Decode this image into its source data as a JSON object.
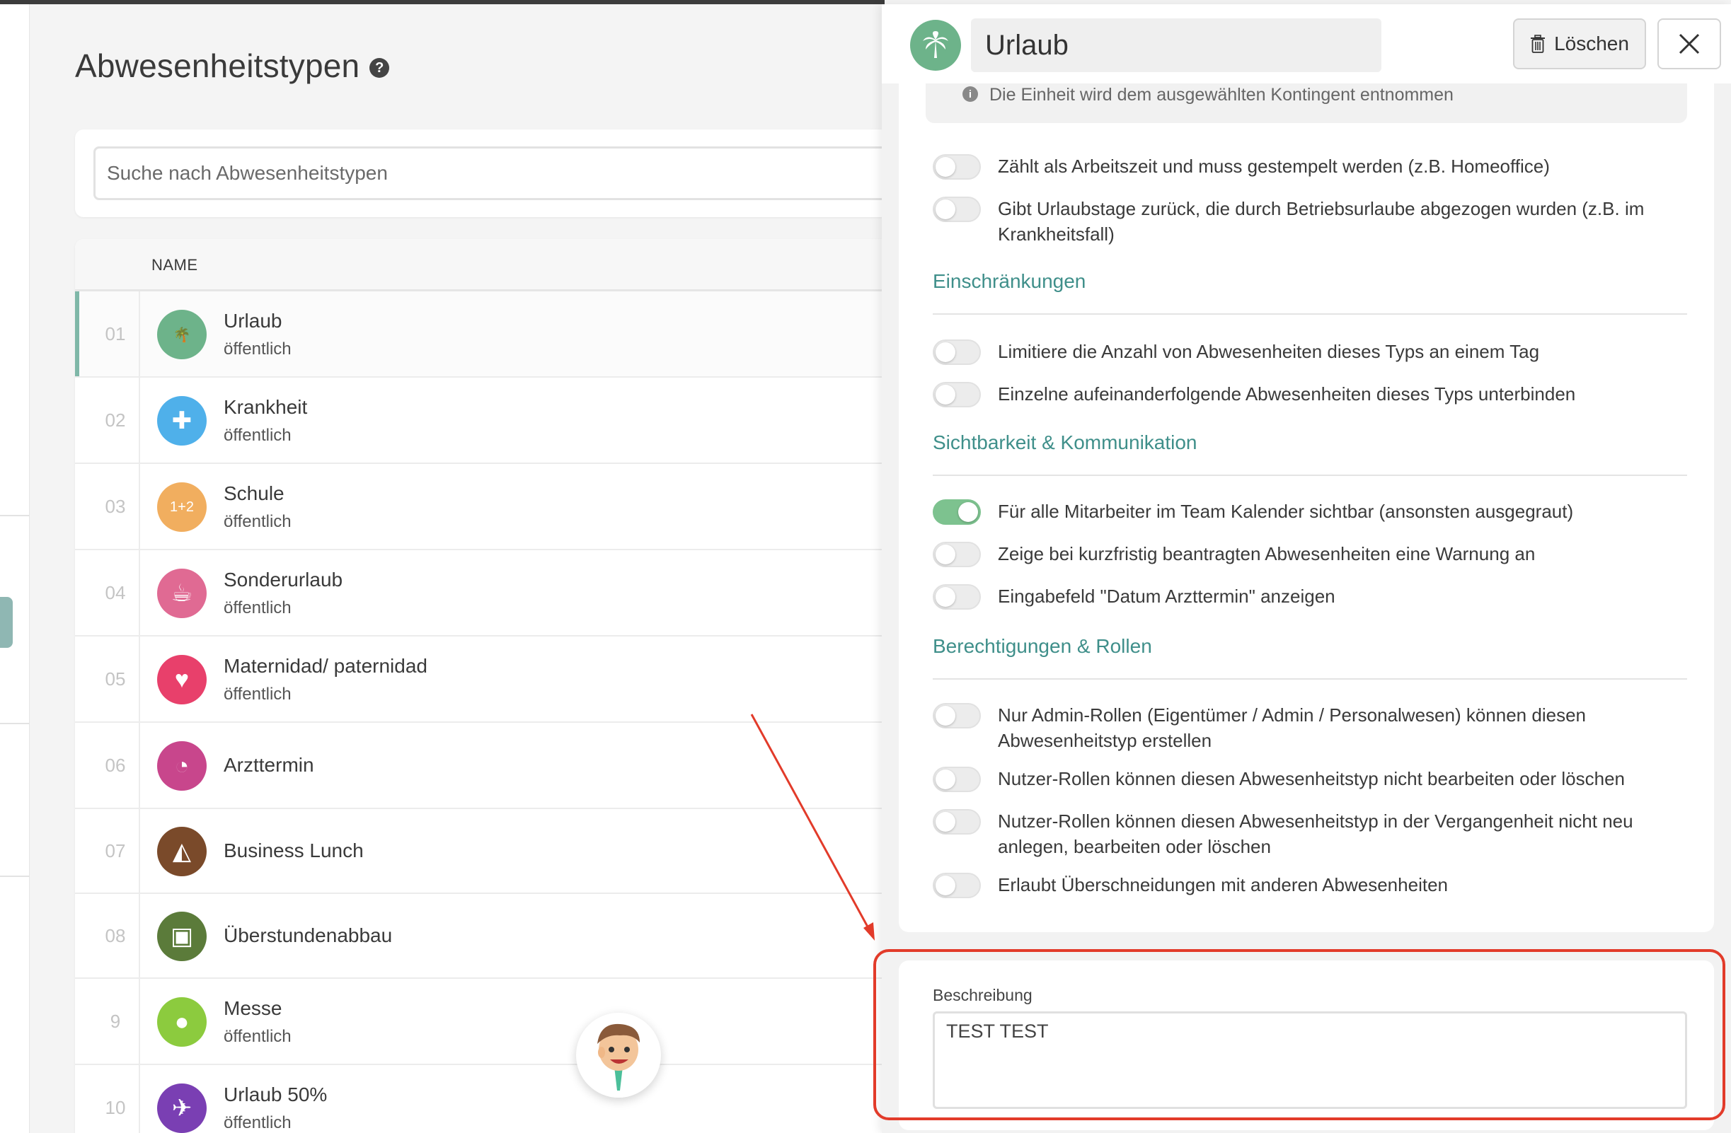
{
  "page": {
    "title": "Abwesenheitstypen",
    "search_placeholder": "Suche nach Abwesenheitstypen",
    "column_name": "NAME"
  },
  "rows": [
    {
      "num": "01",
      "name": "Urlaub",
      "sub": "öffentlich",
      "color": "#6db38a",
      "icon": "palm-tree-icon",
      "glyph": "🌴"
    },
    {
      "num": "02",
      "name": "Krankheit",
      "sub": "öffentlich",
      "color": "#4fb0ea",
      "icon": "medical-cross-icon",
      "glyph": "✚"
    },
    {
      "num": "03",
      "name": "Schule",
      "sub": "öffentlich",
      "color": "#f1ae5f",
      "icon": "chalkboard-icon",
      "glyph": "1+2"
    },
    {
      "num": "04",
      "name": "Sonderurlaub",
      "sub": "öffentlich",
      "color": "#e06a93",
      "icon": "coffee-cup-icon",
      "glyph": "☕"
    },
    {
      "num": "05",
      "name": "Maternidad/ paternidad",
      "sub": "öffentlich",
      "color": "#e8406b",
      "icon": "hearts-icon",
      "glyph": "♥"
    },
    {
      "num": "06",
      "name": "Arzttermin",
      "sub": "",
      "color": "#c8468c",
      "icon": "clock-icon",
      "glyph": "◔"
    },
    {
      "num": "07",
      "name": "Business Lunch",
      "sub": "",
      "color": "#7a4a2a",
      "icon": "cake-slice-icon",
      "glyph": "◭"
    },
    {
      "num": "08",
      "name": "Überstundenabbau",
      "sub": "",
      "color": "#5b7b3a",
      "icon": "suitcase-icon",
      "glyph": "▣"
    },
    {
      "num": "9",
      "name": "Messe",
      "sub": "öffentlich",
      "color": "#8ccb3e",
      "icon": "apple-icon",
      "glyph": "●"
    },
    {
      "num": "10",
      "name": "Urlaub 50%",
      "sub": "öffentlich",
      "color": "#7a3fb3",
      "icon": "airplane-icon",
      "glyph": "✈"
    }
  ],
  "panel": {
    "title": "Urlaub",
    "delete_label": "Löschen",
    "info_text": "Die Einheit wird dem ausgewählten Kontingent entnommen",
    "options_general": [
      {
        "label": "Zählt als Arbeitszeit und muss gestempelt werden (z.B. Homeoffice)",
        "on": false
      },
      {
        "label": "Gibt Urlaubstage zurück, die durch Betriebsurlaube abgezogen wurden (z.B. im Krankheitsfall)",
        "on": false
      }
    ],
    "sections": [
      {
        "title": "Einschränkungen",
        "options": [
          {
            "label": "Limitiere die Anzahl von Abwesenheiten dieses Typs an einem Tag",
            "on": false
          },
          {
            "label": "Einzelne aufeinanderfolgende Abwesenheiten dieses Typs unterbinden",
            "on": false
          }
        ]
      },
      {
        "title": "Sichtbarkeit & Kommunikation",
        "options": [
          {
            "label": "Für alle Mitarbeiter im Team Kalender sichtbar (ansonsten ausgegraut)",
            "on": true
          },
          {
            "label": "Zeige bei kurzfristig beantragten Abwesenheiten eine Warnung an",
            "on": false
          },
          {
            "label": "Eingabefeld \"Datum Arzttermin\" anzeigen",
            "on": false
          }
        ]
      },
      {
        "title": "Berechtigungen & Rollen",
        "options": [
          {
            "label": "Nur Admin-Rollen (Eigentümer / Admin / Personalwesen) können diesen Abwesenheitstyp erstellen",
            "on": false
          },
          {
            "label": "Nutzer-Rollen können diesen Abwesenheitstyp nicht bearbeiten oder löschen",
            "on": false
          },
          {
            "label": "Nutzer-Rollen können diesen Abwesenheitstyp in der Vergangenheit nicht neu anlegen, bearbeiten oder löschen",
            "on": false
          },
          {
            "label": "Erlaubt Überschneidungen mit anderen Abwesenheiten",
            "on": false
          }
        ]
      }
    ],
    "description_label": "Beschreibung",
    "description_value": "TEST TEST"
  },
  "colors": {
    "accent": "#3f8f8a",
    "toggle_on": "#7dc28f",
    "annotation": "#e23b2a"
  }
}
